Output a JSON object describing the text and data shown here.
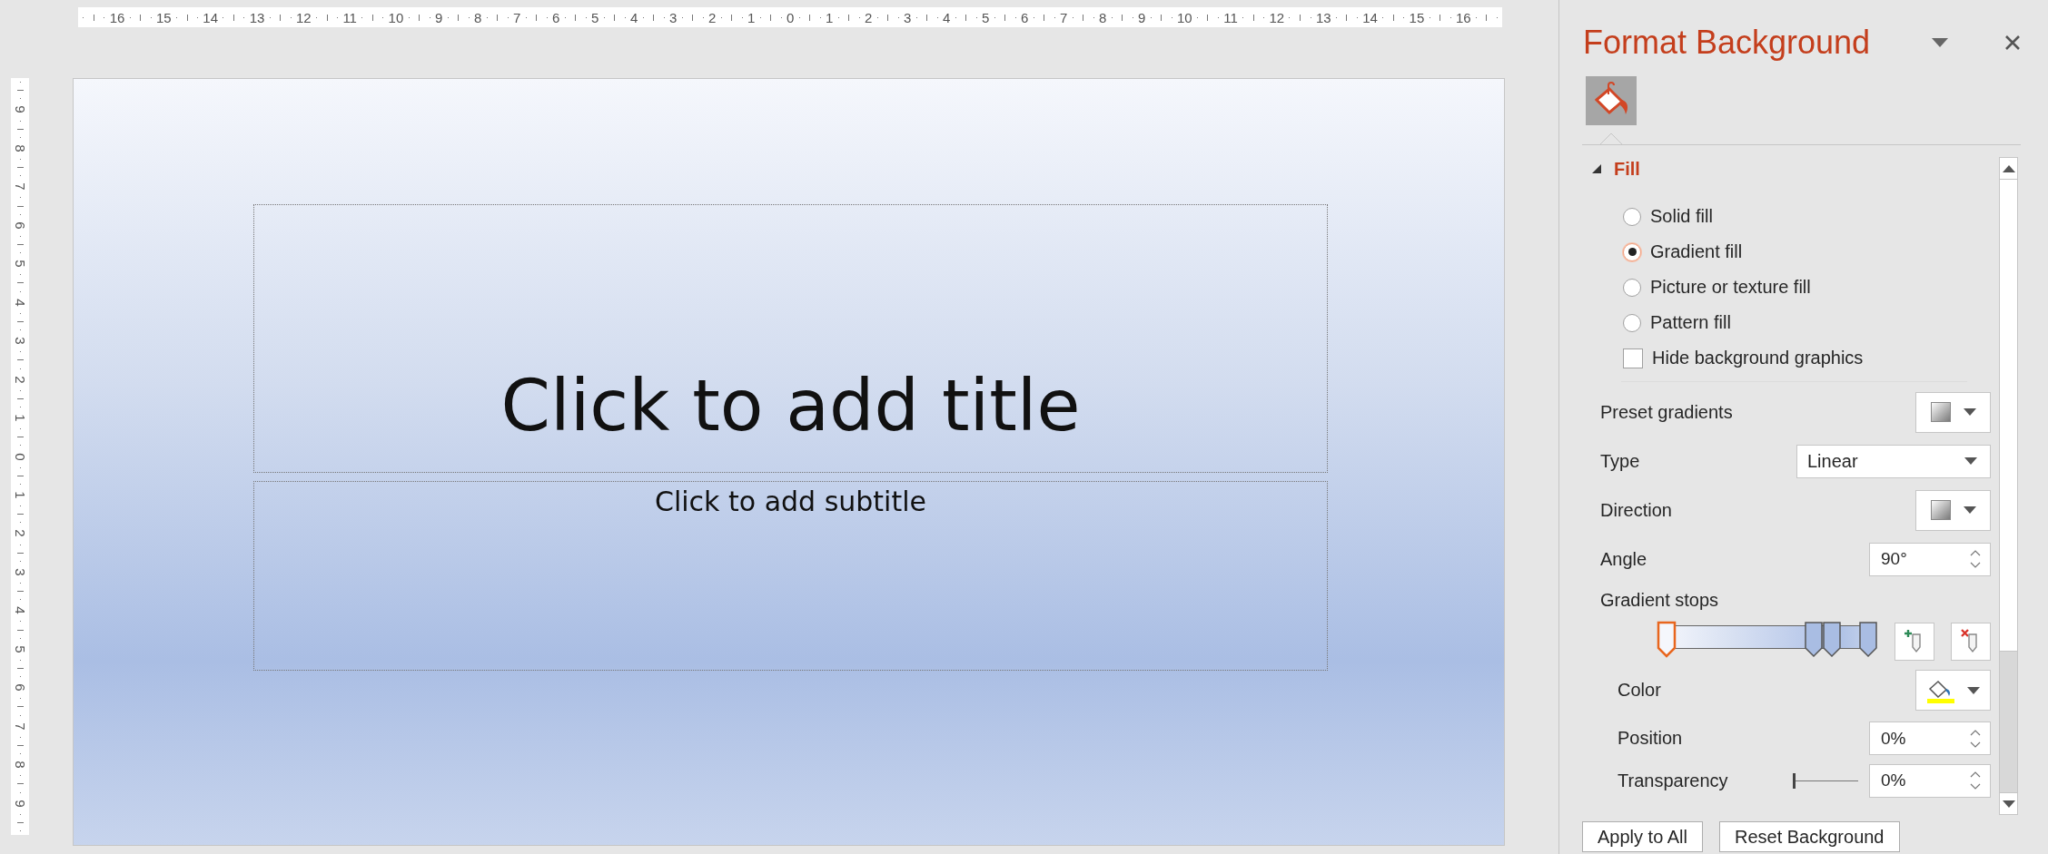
{
  "rulers": {
    "horizontal": [
      "16",
      "15",
      "14",
      "13",
      "12",
      "11",
      "10",
      "9",
      "8",
      "7",
      "6",
      "5",
      "4",
      "3",
      "2",
      "1",
      "0",
      "1",
      "2",
      "3",
      "4",
      "5",
      "6",
      "7",
      "8",
      "9",
      "10",
      "11",
      "12",
      "13",
      "14",
      "15",
      "16"
    ],
    "vertical": [
      "9",
      "8",
      "7",
      "6",
      "5",
      "4",
      "3",
      "2",
      "1",
      "0",
      "1",
      "2",
      "3",
      "4",
      "5",
      "6",
      "7",
      "8",
      "9"
    ]
  },
  "slide": {
    "title": "Click to add title",
    "subtitle": "Click to add subtitle"
  },
  "panel": {
    "title": "Format Background",
    "tabs": [
      {
        "kind": "fill",
        "selected": true
      }
    ],
    "section": {
      "title": "Fill",
      "expanded": true
    },
    "fill_options": [
      {
        "kind": "radio",
        "label": "Solid fill",
        "selected": false
      },
      {
        "kind": "radio",
        "label": "Gradient fill",
        "selected": true
      },
      {
        "kind": "radio",
        "label": "Picture or texture fill",
        "selected": false
      },
      {
        "kind": "radio",
        "label": "Pattern fill",
        "selected": false
      },
      {
        "kind": "checkbox",
        "label": "Hide background graphics",
        "checked": false
      }
    ],
    "settings": [
      {
        "kind": "swatch",
        "label": "Preset gradients"
      },
      {
        "kind": "select",
        "label": "Type",
        "value": "Linear"
      },
      {
        "kind": "swatch",
        "label": "Direction"
      },
      {
        "kind": "spin",
        "label": "Angle",
        "value": "90°"
      }
    ],
    "gradient_stops": {
      "label": "Gradient stops",
      "stops": [
        {
          "selected": true,
          "level": 0
        },
        {
          "selected": false,
          "level": 0.73
        },
        {
          "selected": false,
          "level": 0.82
        },
        {
          "selected": false,
          "level": 1
        }
      ]
    },
    "stop_settings": [
      {
        "kind": "color",
        "label": "Color"
      },
      {
        "kind": "spin",
        "label": "Position",
        "value": "0%"
      },
      {
        "kind": "slider",
        "label": "Transparency",
        "level": 0,
        "value": "0%"
      }
    ],
    "buttons": [
      "Apply to All",
      "Reset Background"
    ]
  }
}
